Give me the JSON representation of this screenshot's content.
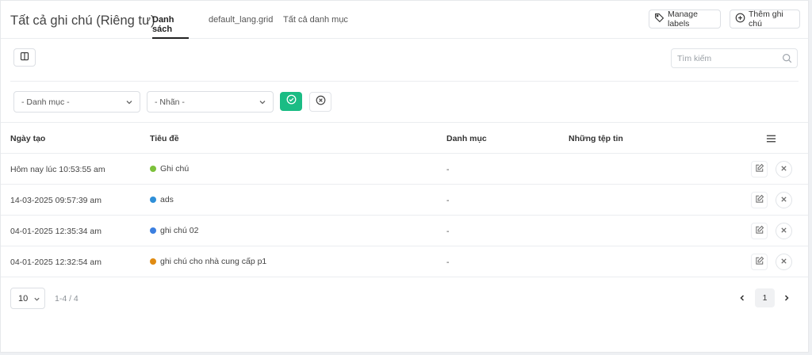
{
  "header": {
    "title": "Tất cả ghi chú (Riêng tư)",
    "tabs": [
      {
        "label": "Danh sách",
        "active": true
      },
      {
        "label": "default_lang.grid",
        "active": false
      },
      {
        "label": "Tất cả danh mục",
        "active": false
      }
    ],
    "manage_labels": "Manage labels",
    "add_note": "Thêm ghi chú"
  },
  "toolbar": {
    "search_placeholder": "Tìm kiếm"
  },
  "filters": {
    "category": "- Danh mục -",
    "label": "- Nhãn -"
  },
  "table": {
    "columns": [
      "Ngày tạo",
      "Tiêu đề",
      "Danh mục",
      "Những tệp tin"
    ],
    "rows": [
      {
        "date": "Hôm nay lúc 10:53:55 am",
        "title": "Ghi chú",
        "color": "#7cc13b",
        "category": "-"
      },
      {
        "date": "14-03-2025 09:57:39 am",
        "title": "ads",
        "color": "#2f8fd8",
        "category": "-"
      },
      {
        "date": "04-01-2025 12:35:34 am",
        "title": "ghi chú 02",
        "color": "#3b7fe0",
        "category": "-"
      },
      {
        "date": "04-01-2025 12:32:54 am",
        "title": "ghi chú cho nhà cung cấp p1",
        "color": "#e08b12",
        "category": "-"
      }
    ]
  },
  "footer": {
    "page_size": "10",
    "range": "1-4 / 4",
    "current_page": "1"
  },
  "colors": {
    "accent": "#1bbc84"
  }
}
